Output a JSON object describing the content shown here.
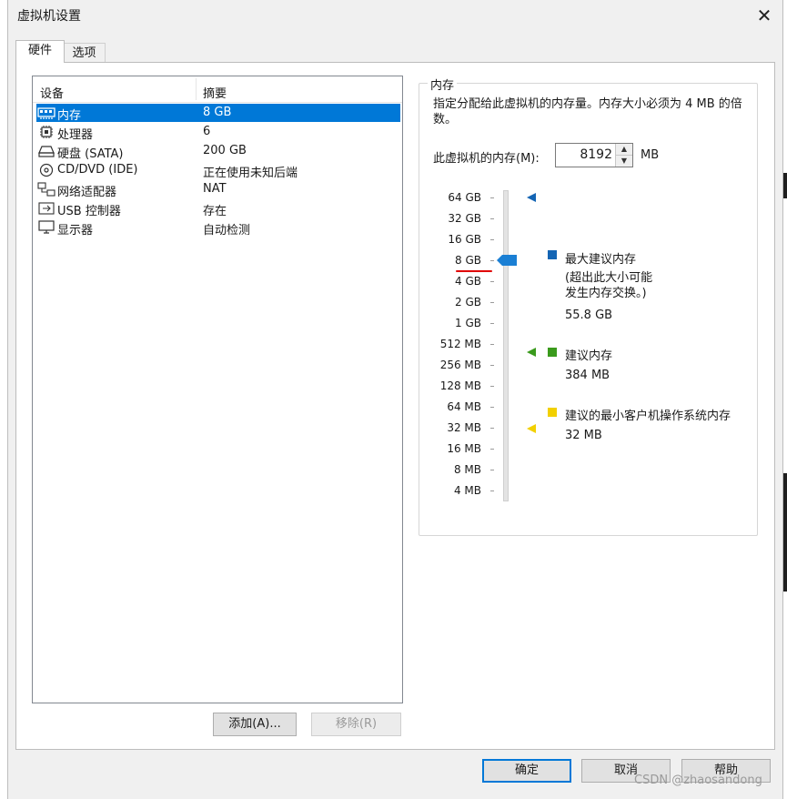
{
  "window": {
    "title": "虚拟机设置",
    "close_glyph": "✕"
  },
  "tabs": [
    {
      "label": "硬件",
      "active": true
    },
    {
      "label": "选项",
      "active": false
    }
  ],
  "device_list": {
    "columns": [
      "设备",
      "摘要"
    ],
    "rows": [
      {
        "icon": "memory-icon",
        "name": "内存",
        "summary": "8 GB",
        "selected": true
      },
      {
        "icon": "processor-icon",
        "name": "处理器",
        "summary": "6",
        "selected": false
      },
      {
        "icon": "harddisk-icon",
        "name": "硬盘 (SATA)",
        "summary": "200 GB",
        "selected": false
      },
      {
        "icon": "cd-dvd-icon",
        "name": "CD/DVD (IDE)",
        "summary": "正在使用未知后端",
        "selected": false
      },
      {
        "icon": "network-adapter-icon",
        "name": "网络适配器",
        "summary": "NAT",
        "selected": false
      },
      {
        "icon": "usb-icon",
        "name": "USB 控制器",
        "summary": "存在",
        "selected": false
      },
      {
        "icon": "display-icon",
        "name": "显示器",
        "summary": "自动检测",
        "selected": false
      }
    ]
  },
  "list_buttons": {
    "add": "添加(A)...",
    "remove": "移除(R)"
  },
  "memory_panel": {
    "group_title": "内存",
    "description": "指定分配给此虚拟机的内存量。内存大小必须为 4 MB 的倍数。",
    "memory_label": "此虚拟机的内存(M):",
    "memory_value": "8192",
    "unit": "MB",
    "scale_labels": [
      "64 GB",
      "32 GB",
      "16 GB",
      "8 GB",
      "4 GB",
      "2 GB",
      "1 GB",
      "512 MB",
      "256 MB",
      "128 MB",
      "64 MB",
      "32 MB",
      "16 MB",
      "8 MB",
      "4 MB"
    ],
    "current_level": "8 GB",
    "legend": {
      "max": {
        "title": "最大建议内存",
        "note_line1": "(超出此大小可能",
        "note_line2": "发生内存交换。)",
        "value": "55.8 GB",
        "color": "#1465b4"
      },
      "recommended": {
        "title": "建议内存",
        "value": "384 MB",
        "color": "#3a9a1c"
      },
      "min_guest": {
        "title": "建议的最小客户机操作系统内存",
        "value": "32 MB",
        "color": "#f2d000"
      }
    }
  },
  "footer_buttons": {
    "ok": "确定",
    "cancel": "取消",
    "help": "帮助"
  },
  "watermark": "CSDN @zhaosandong",
  "colors": {
    "selection": "#0078d7",
    "thumb": "#1a7fd4",
    "annotation_red": "#e00000"
  }
}
